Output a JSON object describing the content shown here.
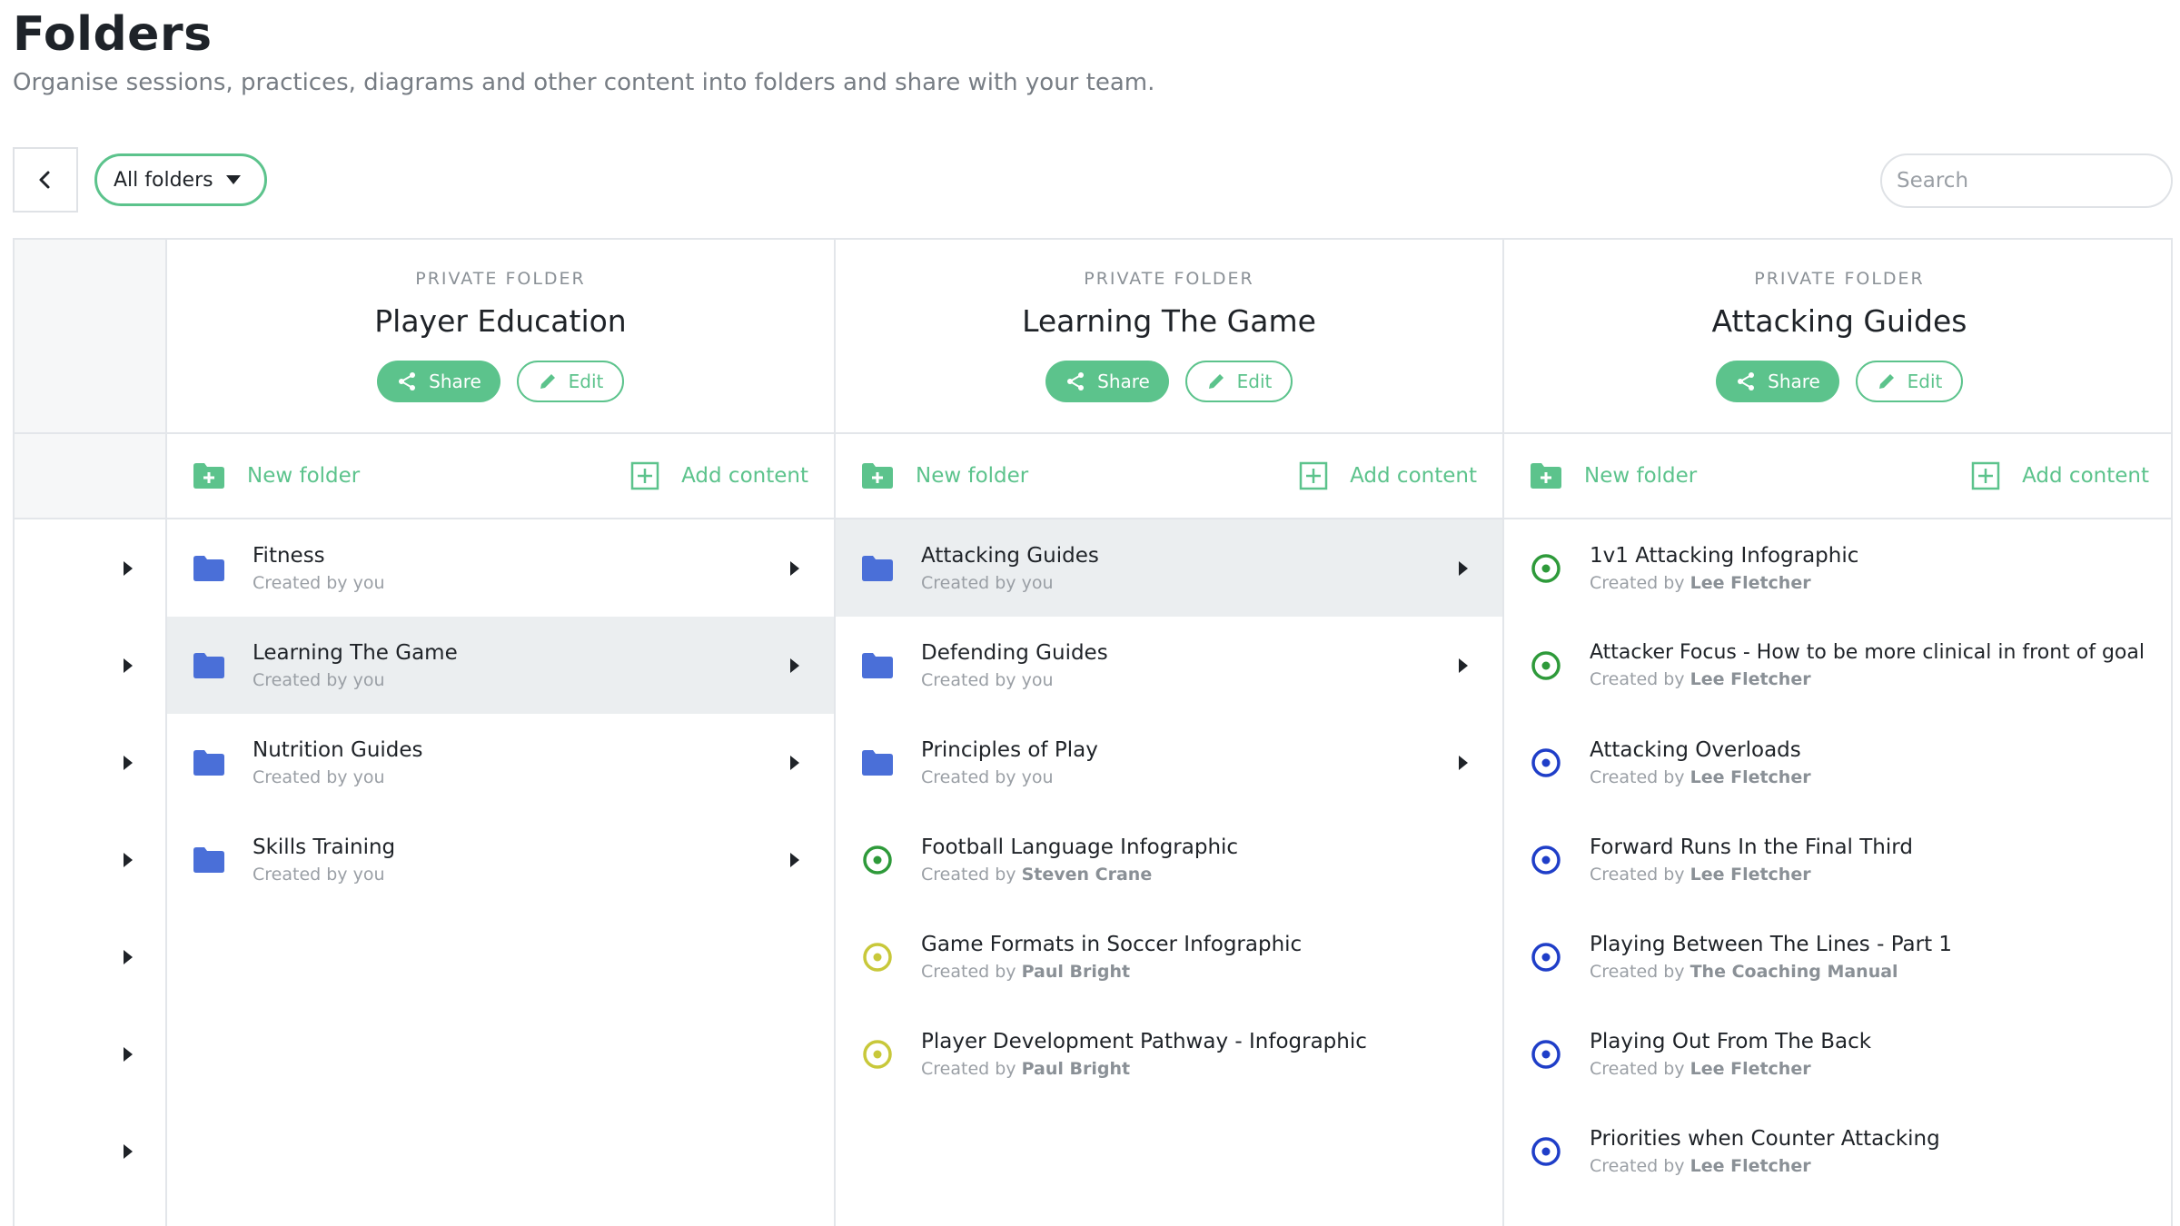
{
  "header": {
    "title": "Folders",
    "subtitle": "Organise sessions, practices, diagrams and other content into folders and share with your team."
  },
  "toolbar": {
    "folder_filter": "All folders",
    "search_placeholder": "Search"
  },
  "colors": {
    "accent": "#5cc38c",
    "folder": "#4a6fd8",
    "content_green": "#2e9a3a",
    "content_yellow": "#c8c83a",
    "content_blue": "#1f3ec8"
  },
  "columns": [
    {
      "kicker": "PRIVATE FOLDER",
      "title": "Player Education",
      "share_label": "Share",
      "edit_label": "Edit",
      "new_folder_label": "New folder",
      "add_content_label": "Add content",
      "items": [
        {
          "name": "Fitness",
          "prefix": "Created by",
          "author": "you",
          "type": "folder"
        },
        {
          "name": "Learning The Game",
          "prefix": "Created by",
          "author": "you",
          "type": "folder"
        },
        {
          "name": "Nutrition Guides",
          "prefix": "Created by",
          "author": "you",
          "type": "folder"
        },
        {
          "name": "Skills Training",
          "prefix": "Created by",
          "author": "you",
          "type": "folder"
        }
      ]
    },
    {
      "kicker": "PRIVATE FOLDER",
      "title": "Learning The Game",
      "share_label": "Share",
      "edit_label": "Edit",
      "new_folder_label": "New folder",
      "add_content_label": "Add content",
      "items": [
        {
          "name": "Attacking Guides",
          "prefix": "Created by",
          "author": "you",
          "type": "folder"
        },
        {
          "name": "Defending Guides",
          "prefix": "Created by",
          "author": "you",
          "type": "folder"
        },
        {
          "name": "Principles of Play",
          "prefix": "Created by",
          "author": "you",
          "type": "folder"
        },
        {
          "name": "Football Language Infographic",
          "prefix": "Created by",
          "author": "Steven Crane",
          "type": "content-green"
        },
        {
          "name": "Game Formats in Soccer Infographic",
          "prefix": "Created by",
          "author": "Paul Bright",
          "type": "content-yellow"
        },
        {
          "name": "Player Development Pathway - Infographic",
          "prefix": "Created by",
          "author": "Paul Bright",
          "type": "content-yellow"
        }
      ]
    },
    {
      "kicker": "PRIVATE FOLDER",
      "title": "Attacking Guides",
      "share_label": "Share",
      "edit_label": "Edit",
      "new_folder_label": "New folder",
      "add_content_label": "Add content",
      "items": [
        {
          "name": "1v1 Attacking Infographic",
          "prefix": "Created by",
          "author": "Lee Fletcher",
          "type": "content-green"
        },
        {
          "name": "Attacker Focus - How to be more clinical in front of goal",
          "prefix": "Created by",
          "author": "Lee Fletcher",
          "type": "content-green"
        },
        {
          "name": "Attacking Overloads",
          "prefix": "Created by",
          "author": "Lee Fletcher",
          "type": "content-blue"
        },
        {
          "name": "Forward Runs In the Final Third",
          "prefix": "Created by",
          "author": "Lee Fletcher",
          "type": "content-blue"
        },
        {
          "name": "Playing Between The Lines - Part 1",
          "prefix": "Created by",
          "author": "The Coaching Manual",
          "type": "content-blue"
        },
        {
          "name": "Playing Out From The Back",
          "prefix": "Created by",
          "author": "Lee Fletcher",
          "type": "content-blue"
        },
        {
          "name": "Priorities when Counter Attacking",
          "prefix": "Created by",
          "author": "Lee Fletcher",
          "type": "content-blue"
        }
      ]
    }
  ]
}
